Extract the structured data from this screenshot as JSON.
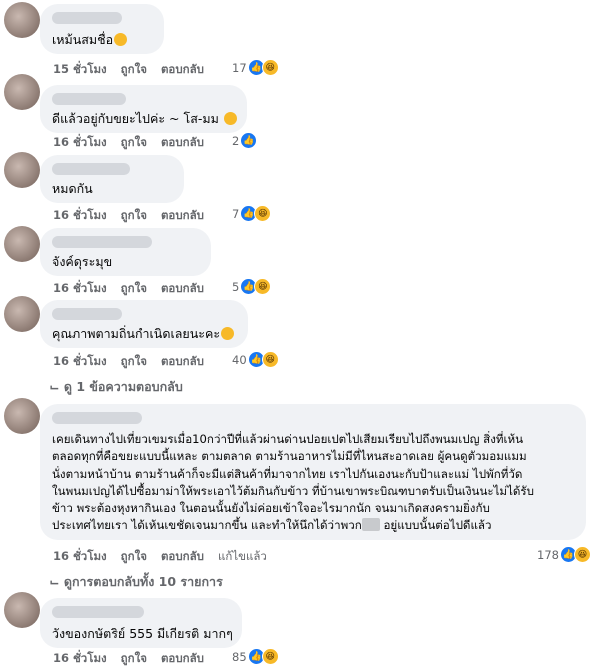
{
  "comments": [
    {
      "text": "เหม้นสมชื่อ",
      "time": "15 ชั่วโมง",
      "like": "ถูกใจ",
      "reply": "ตอบกลับ",
      "count": "17"
    },
    {
      "text": "ดีแล้วอยู่กับขยะไปค่ะ ~ โส-มม",
      "time": "16 ชั่วโมง",
      "like": "ถูกใจ",
      "reply": "ตอบกลับ",
      "count": "2"
    },
    {
      "text": "หมดกัน",
      "time": "16 ชั่วโมง",
      "like": "ถูกใจ",
      "reply": "ตอบกลับ",
      "count": "7"
    },
    {
      "text": "จังค์ดุระมุข",
      "time": "16 ชั่วโมง",
      "like": "ถูกใจ",
      "reply": "ตอบกลับ",
      "count": "5"
    },
    {
      "text": "คุณภาพตามถิ่นกำเนิดเลยนะคะ",
      "time": "16 ชั่วโมง",
      "like": "ถูกใจ",
      "reply": "ตอบกลับ",
      "count": "40"
    },
    {
      "text_a": "เคยเดินทางไปเที่ยวเขมรเมื่อ10กว่าปีที่แล้วผ่านด่านปอยเปตไปเสียมเรียบไปถึงพนมเปญ สิ่งที่เห้น\nตลอดทุกที่คือขยะแบบนี้แหละ ตามตลาด ตามร้านอาหารไม่มีที่ไหนสะอาดเลย ผู้คนดูตัวมอมแมม\nนั่งตามหน้าบ้าน ตามร้านค้าก็จะมีแต่สินค้าที่มาจากไทย เราไปกันเองนะกับป้าและแม่ ไปพักที่วัด\nในพนมเปญได้ไปซื้อมาม่าให้พระเอาไว้ต้มกินกับข้าว ที่บ้านเขาพระบิณฑบาตรับเป็นเงินนะไม่ได้รับ\nข้าว พระต้องหุงหากินเอง ในตอนนั้นยังไม่ค่อยเข้าใจอะไรมากนัก จนมาเกิดสงครามยิ่งกับ\nประเทศไทยเรา ได้เห้นเขชัดเจนมากขึ้น และทำให้นึกได้ว่าพวก",
      "text_b": " อยู่แบบนั้นต่อไปดีแล้ว",
      "time": "16 ชั่วโมง",
      "like": "ถูกใจ",
      "reply": "ตอบกลับ",
      "edited": "แก้ไขแล้ว",
      "count": "178"
    },
    {
      "text": "วังของกษัตริย์ 555 มีเกียรติ มากๆ",
      "time": "16 ชั่วโมง",
      "like": "ถูกใจ",
      "reply": "ตอบกลับ",
      "count": "85"
    }
  ],
  "view_replies_1": "ดู 1 ข้อความตอบกลับ",
  "view_replies_all": "ดูการตอบกลับทั้ง 10 รายการ",
  "icons": {
    "like": "thumbs-up-icon",
    "haha": "haha-icon",
    "smile": "smile-emoji-icon",
    "reply_arrow": "reply-arrow-icon"
  },
  "colors": {
    "like": "#1877f2",
    "haha": "#f7b928",
    "bubble": "#f0f2f5",
    "meta": "#65676b"
  }
}
